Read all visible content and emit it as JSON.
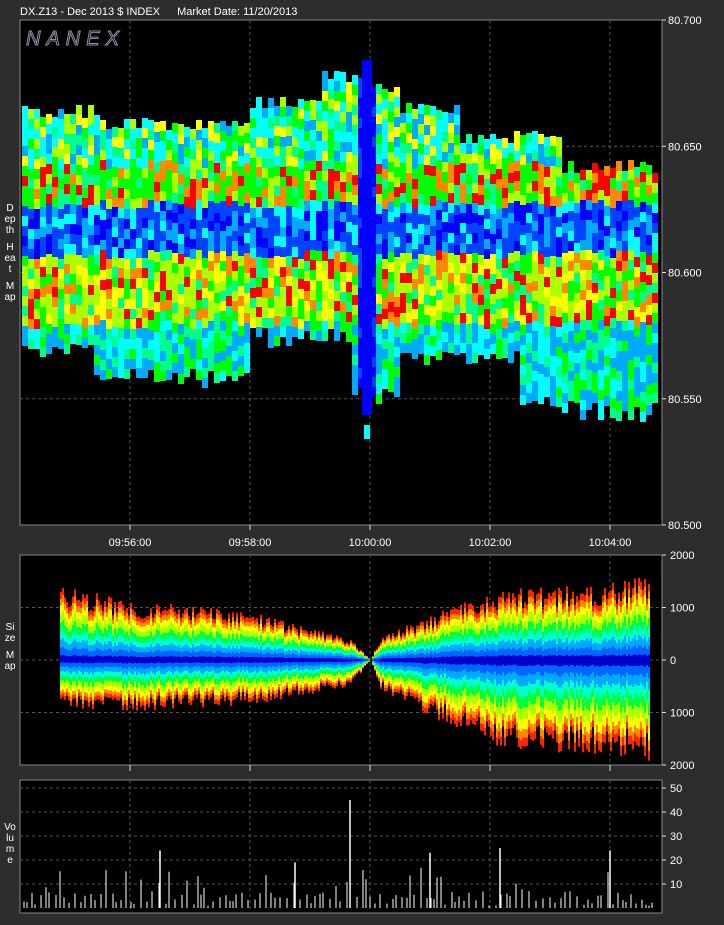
{
  "header": {
    "symbol": "DX.Z13 - Dec 2013 $ INDEX",
    "market_date": "Market Date: 11/20/2013"
  },
  "brand": "NANEX",
  "panel_labels": {
    "depth": [
      "Depth",
      "Heat",
      "Map"
    ],
    "size": [
      "Size",
      "Map"
    ],
    "volume": [
      "Volume"
    ]
  },
  "chart_data": [
    {
      "type": "heatmap",
      "name_printed": "Depth Heat Map",
      "x_tick_labels": [
        "09:56:00",
        "09:58:00",
        "10:00:00",
        "10:02:00",
        "10:04:00"
      ],
      "y_tick_labels": [
        "80.700",
        "80.650",
        "80.600",
        "80.550",
        "80.500"
      ],
      "ylim": [
        80.5,
        80.7
      ],
      "grid": true,
      "colors": [
        "#0000ff",
        "#0044ff",
        "#00aaff",
        "#00ffff",
        "#00ff88",
        "#00ff00",
        "#aaff00",
        "#ffff00",
        "#ff8800",
        "#ff0000"
      ]
    },
    {
      "type": "area",
      "name_printed": "Size Map",
      "y_tick_labels": [
        "2000",
        "1000",
        "0",
        "1000",
        "2000"
      ],
      "ylim": [
        -2000,
        2000
      ],
      "grid": true,
      "bid_envelope": {
        "times": [
          "09:54:50",
          "09:56:00",
          "09:58:00",
          "09:59:40",
          "10:00:00",
          "10:00:10",
          "10:02:00",
          "10:04:00",
          "10:04:40"
        ],
        "upper": [
          1250,
          1000,
          800,
          350,
          0,
          400,
          1150,
          1300,
          1400
        ],
        "lower": [
          -850,
          -850,
          -750,
          -450,
          0,
          -500,
          -1450,
          -1600,
          -1700
        ]
      }
    },
    {
      "type": "bar",
      "name_printed": "Volume",
      "y_tick_labels": [
        "50",
        "40",
        "30",
        "20",
        "10"
      ],
      "ylim": [
        0,
        50
      ],
      "grid": true,
      "notable_bars": [
        {
          "time": "09:56:30",
          "volume": 24
        },
        {
          "time": "09:58:45",
          "volume": 19
        },
        {
          "time": "09:59:40",
          "volume": 45
        },
        {
          "time": "10:01:00",
          "volume": 23
        },
        {
          "time": "10:02:10",
          "volume": 25
        },
        {
          "time": "10:04:00",
          "volume": 24
        }
      ]
    }
  ]
}
